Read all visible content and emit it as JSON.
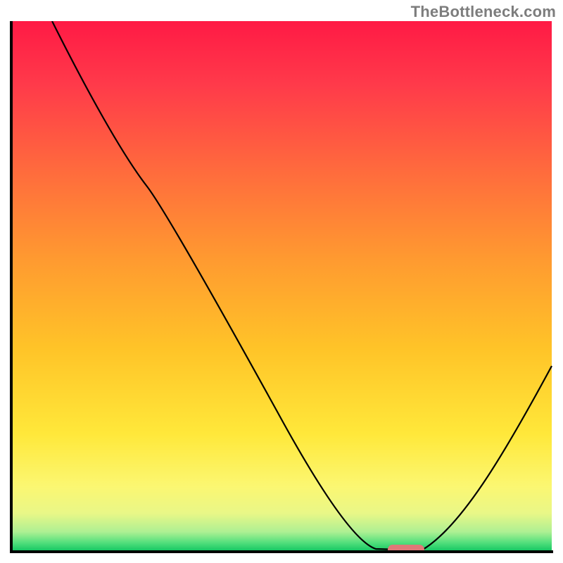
{
  "attribution": "TheBottleneck.com",
  "chart_data": {
    "type": "line",
    "title": "",
    "xlabel": "",
    "ylabel": "",
    "xlim": [
      0,
      100
    ],
    "ylim": [
      0,
      100
    ],
    "background_gradient": {
      "orientation": "vertical",
      "stops": [
        {
          "pos": 0.0,
          "color": "#ff1a45"
        },
        {
          "pos": 0.12,
          "color": "#ff3a4a"
        },
        {
          "pos": 0.28,
          "color": "#ff6a3d"
        },
        {
          "pos": 0.45,
          "color": "#ff9a30"
        },
        {
          "pos": 0.62,
          "color": "#ffc428"
        },
        {
          "pos": 0.78,
          "color": "#ffe83a"
        },
        {
          "pos": 0.88,
          "color": "#fbf772"
        },
        {
          "pos": 0.93,
          "color": "#e9f787"
        },
        {
          "pos": 0.965,
          "color": "#aef093"
        },
        {
          "pos": 0.985,
          "color": "#55e07d"
        },
        {
          "pos": 1.0,
          "color": "#18c864"
        }
      ]
    },
    "series": [
      {
        "name": "bottleneck-curve",
        "color": "#000000",
        "x": [
          8,
          14,
          20,
          25,
          30,
          38,
          45,
          52,
          58,
          63,
          67,
          72,
          76,
          82,
          88,
          94,
          100
        ],
        "y": [
          100,
          88,
          77,
          69,
          62,
          48,
          36,
          24,
          14,
          6,
          1,
          0,
          0,
          4,
          13,
          25,
          35
        ]
      }
    ],
    "annotations": [
      {
        "name": "optimal-marker",
        "shape": "pill",
        "color": "#e07878",
        "x_range": [
          70,
          77
        ],
        "y": 0
      }
    ],
    "grid": false,
    "legend": false
  }
}
